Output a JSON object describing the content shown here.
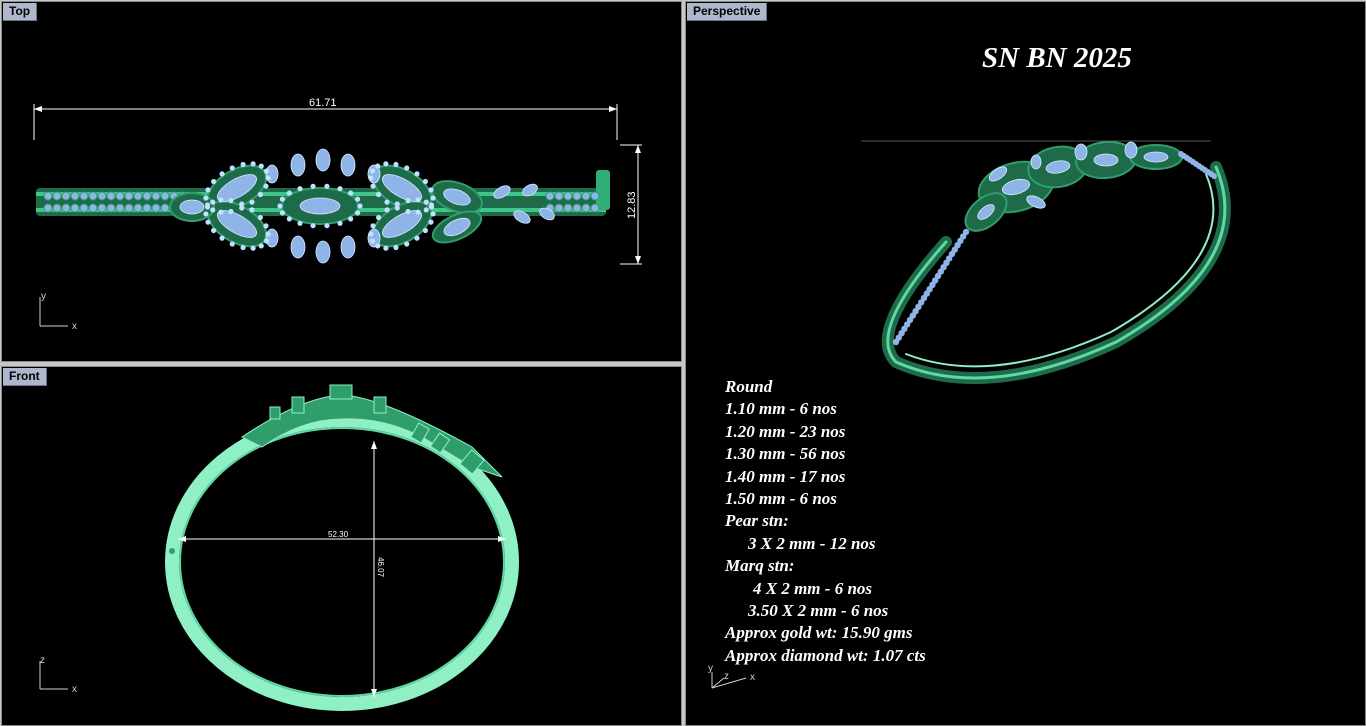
{
  "viewports": {
    "top": {
      "label": "Top",
      "dim_width": "61.71",
      "dim_height": "12.83",
      "axis_x": "x",
      "axis_y": "y"
    },
    "front": {
      "label": "Front",
      "dim_width": "52.30",
      "dim_height": "46.07",
      "axis_x": "x",
      "axis_y": "z"
    },
    "perspective": {
      "label": "Perspective",
      "axis_x": "x",
      "axis_y": "y",
      "axis_z": "z"
    }
  },
  "title": "SN BN 2025",
  "specs": [
    {
      "text": "Round",
      "indent": 0
    },
    {
      "text": "1.10 mm - 6 nos",
      "indent": 0
    },
    {
      "text": "1.20 mm - 23 nos",
      "indent": 0
    },
    {
      "text": "1.30 mm - 56 nos",
      "indent": 0
    },
    {
      "text": "1.40 mm - 17 nos",
      "indent": 0
    },
    {
      "text": "1.50 mm - 6 nos",
      "indent": 0
    },
    {
      "text": "Pear stn:",
      "indent": 0
    },
    {
      "text": "3 X 2 mm - 12 nos",
      "indent": 1
    },
    {
      "text": "Marq stn:",
      "indent": 0
    },
    {
      "text": "4 X 2 mm - 6 nos",
      "indent": 2
    },
    {
      "text": "3.50 X 2 mm - 6 nos",
      "indent": 1
    },
    {
      "text": "Approx gold wt: 15.90 gms",
      "indent": 0
    },
    {
      "text": "Approx diamond wt: 1.07 cts",
      "indent": 0
    }
  ],
  "colors": {
    "viewport_bg": "#000000",
    "tab_bg": "#aeb7cc",
    "metal": "#2f9e6b",
    "metal_light": "#8ef0c4",
    "stone": "#8fb4e8"
  }
}
